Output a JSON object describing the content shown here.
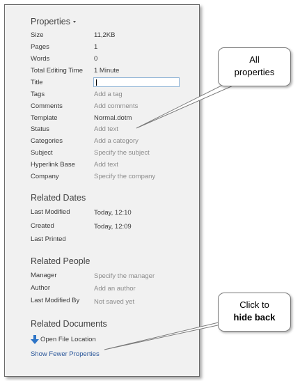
{
  "properties": {
    "title": "Properties",
    "rows": [
      {
        "label": "Size",
        "value": "11,2KB"
      },
      {
        "label": "Pages",
        "value": "1"
      },
      {
        "label": "Words",
        "value": "0"
      },
      {
        "label": "Total Editing Time",
        "value": "1 Minute"
      },
      {
        "label": "Title",
        "value": ""
      },
      {
        "label": "Tags",
        "value": "Add a tag"
      },
      {
        "label": "Comments",
        "value": "Add comments"
      },
      {
        "label": "Template",
        "value": "Normal.dotm"
      },
      {
        "label": "Status",
        "value": "Add text"
      },
      {
        "label": "Categories",
        "value": "Add a category"
      },
      {
        "label": "Subject",
        "value": "Specify the subject"
      },
      {
        "label": "Hyperlink Base",
        "value": "Add text"
      },
      {
        "label": "Company",
        "value": "Specify the company"
      }
    ]
  },
  "related_dates": {
    "title": "Related Dates",
    "rows": [
      {
        "label": "Last Modified",
        "value": "Today, 12:10"
      },
      {
        "label": "Created",
        "value": "Today, 12:09"
      },
      {
        "label": "Last Printed",
        "value": ""
      }
    ]
  },
  "related_people": {
    "title": "Related People",
    "rows": [
      {
        "label": "Manager",
        "value": "Specify the manager"
      },
      {
        "label": "Author",
        "value": "Add an author"
      },
      {
        "label": "Last Modified By",
        "value": "Not saved yet"
      }
    ]
  },
  "related_documents": {
    "title": "Related Documents",
    "open_location": "Open File Location",
    "show_fewer": "Show Fewer Properties"
  },
  "callouts": {
    "all_props_line1": "All",
    "all_props_line2": "properties",
    "hide_line1": "Click to",
    "hide_line2": "hide back"
  },
  "colors": {
    "panel_bg": "#f1f1f1",
    "link": "#2b579a",
    "placeholder": "#8c8c8c",
    "arrow_icon": "#2e75c7"
  }
}
